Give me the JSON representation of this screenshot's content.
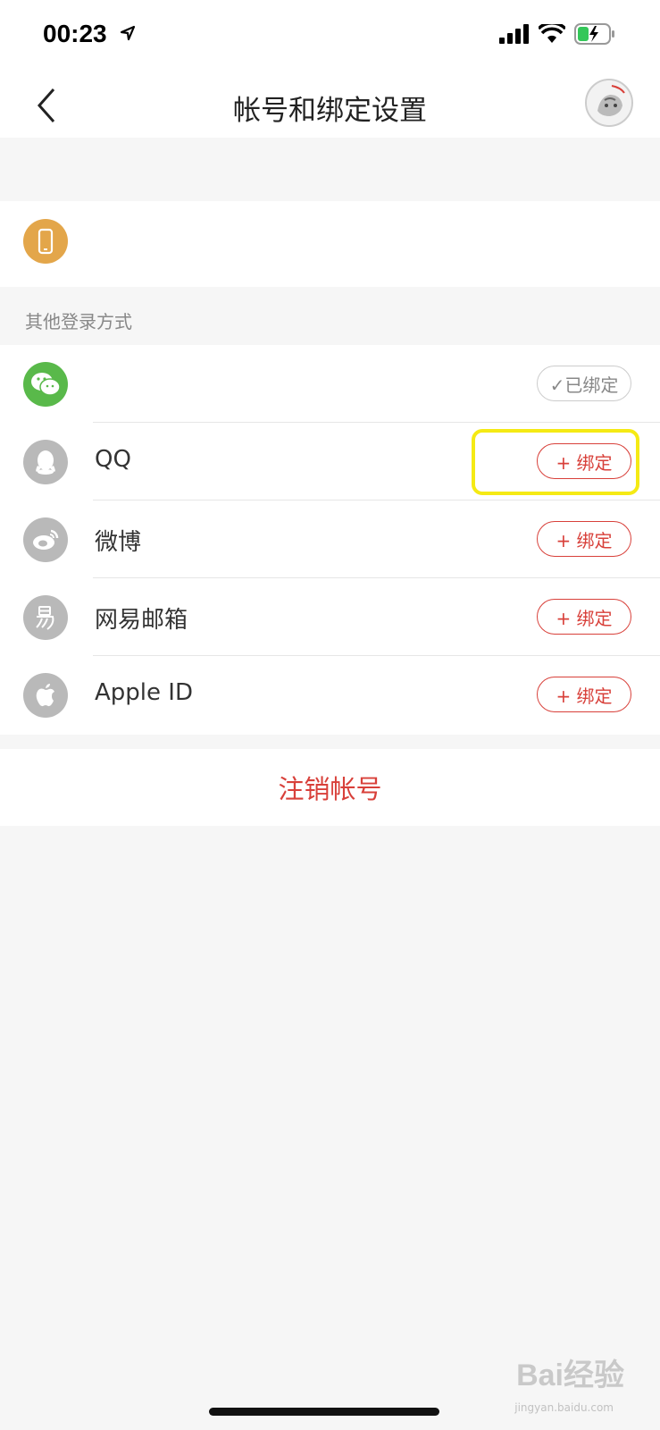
{
  "status_bar": {
    "time": "00:23"
  },
  "nav": {
    "title": "帐号和绑定设置"
  },
  "section": {
    "other_login_label": "其他登录方式"
  },
  "accounts": [
    {
      "name": "",
      "icon": "wechat-icon",
      "color": "#59b94a",
      "button": "✓已绑定",
      "bound": true
    },
    {
      "name": "QQ",
      "icon": "qq-icon",
      "color": "#b9b9b9",
      "button": "+ 绑定",
      "bound": false
    },
    {
      "name": "微博",
      "icon": "weibo-icon",
      "color": "#b9b9b9",
      "button": "+ 绑定",
      "bound": false
    },
    {
      "name": "网易邮箱",
      "icon": "netease-mail-icon",
      "color": "#b9b9b9",
      "button": "+ 绑定",
      "bound": false
    },
    {
      "name": "Apple ID",
      "icon": "apple-icon",
      "color": "#b9b9b9",
      "button": "+ 绑定",
      "bound": false
    }
  ],
  "cancel_account": {
    "label": "注销帐号"
  },
  "watermark": {
    "text": "Bai经验",
    "sub": "jingyan.baidu.com"
  },
  "colors": {
    "accent": "#d8403a",
    "phone_icon": "#e3a64a",
    "wechat": "#59b94a",
    "highlight": "#f5ea14"
  }
}
